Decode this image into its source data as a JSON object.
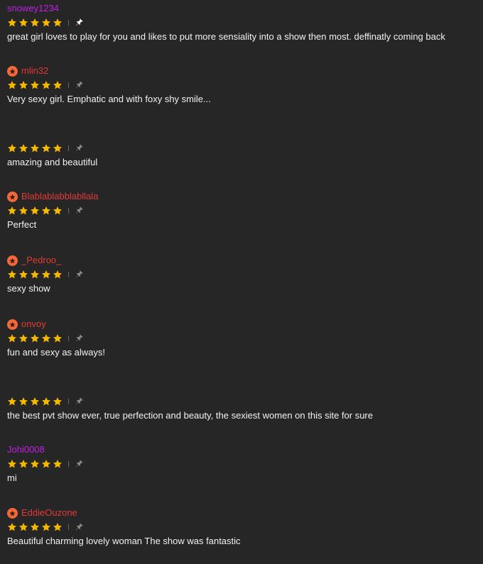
{
  "colors": {
    "background": "#262626",
    "premium_name": "#e53935",
    "regular_name": "#c11fe6",
    "badge": "#f2683a",
    "star": "#f5b800",
    "pin_active": "#ffffff",
    "pin_inactive": "#8a8a8a"
  },
  "reviews": [
    {
      "username": "snowey1234",
      "badge": false,
      "name_style": "regular",
      "rating": 5,
      "pinned": true,
      "comment": "great girl loves to play for you and likes to put more sensiality into a show then most. deffinatly coming back"
    },
    {
      "username": "mlin32",
      "badge": true,
      "name_style": "premium",
      "rating": 5,
      "pinned": false,
      "comment": "Very sexy girl. Emphatic and with foxy shy smile..."
    },
    {
      "username": "",
      "badge": false,
      "name_style": "regular",
      "rating": 5,
      "pinned": false,
      "comment": "amazing and beautiful"
    },
    {
      "username": "Blablablabblabllala",
      "badge": true,
      "name_style": "premium",
      "rating": 5,
      "pinned": false,
      "comment": "Perfect"
    },
    {
      "username": "_Pedroo_",
      "badge": true,
      "name_style": "premium",
      "rating": 5,
      "pinned": false,
      "comment": "sexy show"
    },
    {
      "username": "onvoy",
      "badge": true,
      "name_style": "premium",
      "rating": 5,
      "pinned": false,
      "comment": "fun and sexy as always!"
    },
    {
      "username": "",
      "badge": false,
      "name_style": "regular",
      "rating": 5,
      "pinned": false,
      "comment": "the best pvt show ever, true perfection and beauty, the sexiest women on this site for sure"
    },
    {
      "username": "Johi0008",
      "badge": false,
      "name_style": "regular",
      "rating": 5,
      "pinned": false,
      "comment": "mi"
    },
    {
      "username": "EddieOuzone",
      "badge": true,
      "name_style": "premium",
      "rating": 5,
      "pinned": false,
      "comment": "Beautiful charming lovely woman The show was fantastic"
    }
  ]
}
